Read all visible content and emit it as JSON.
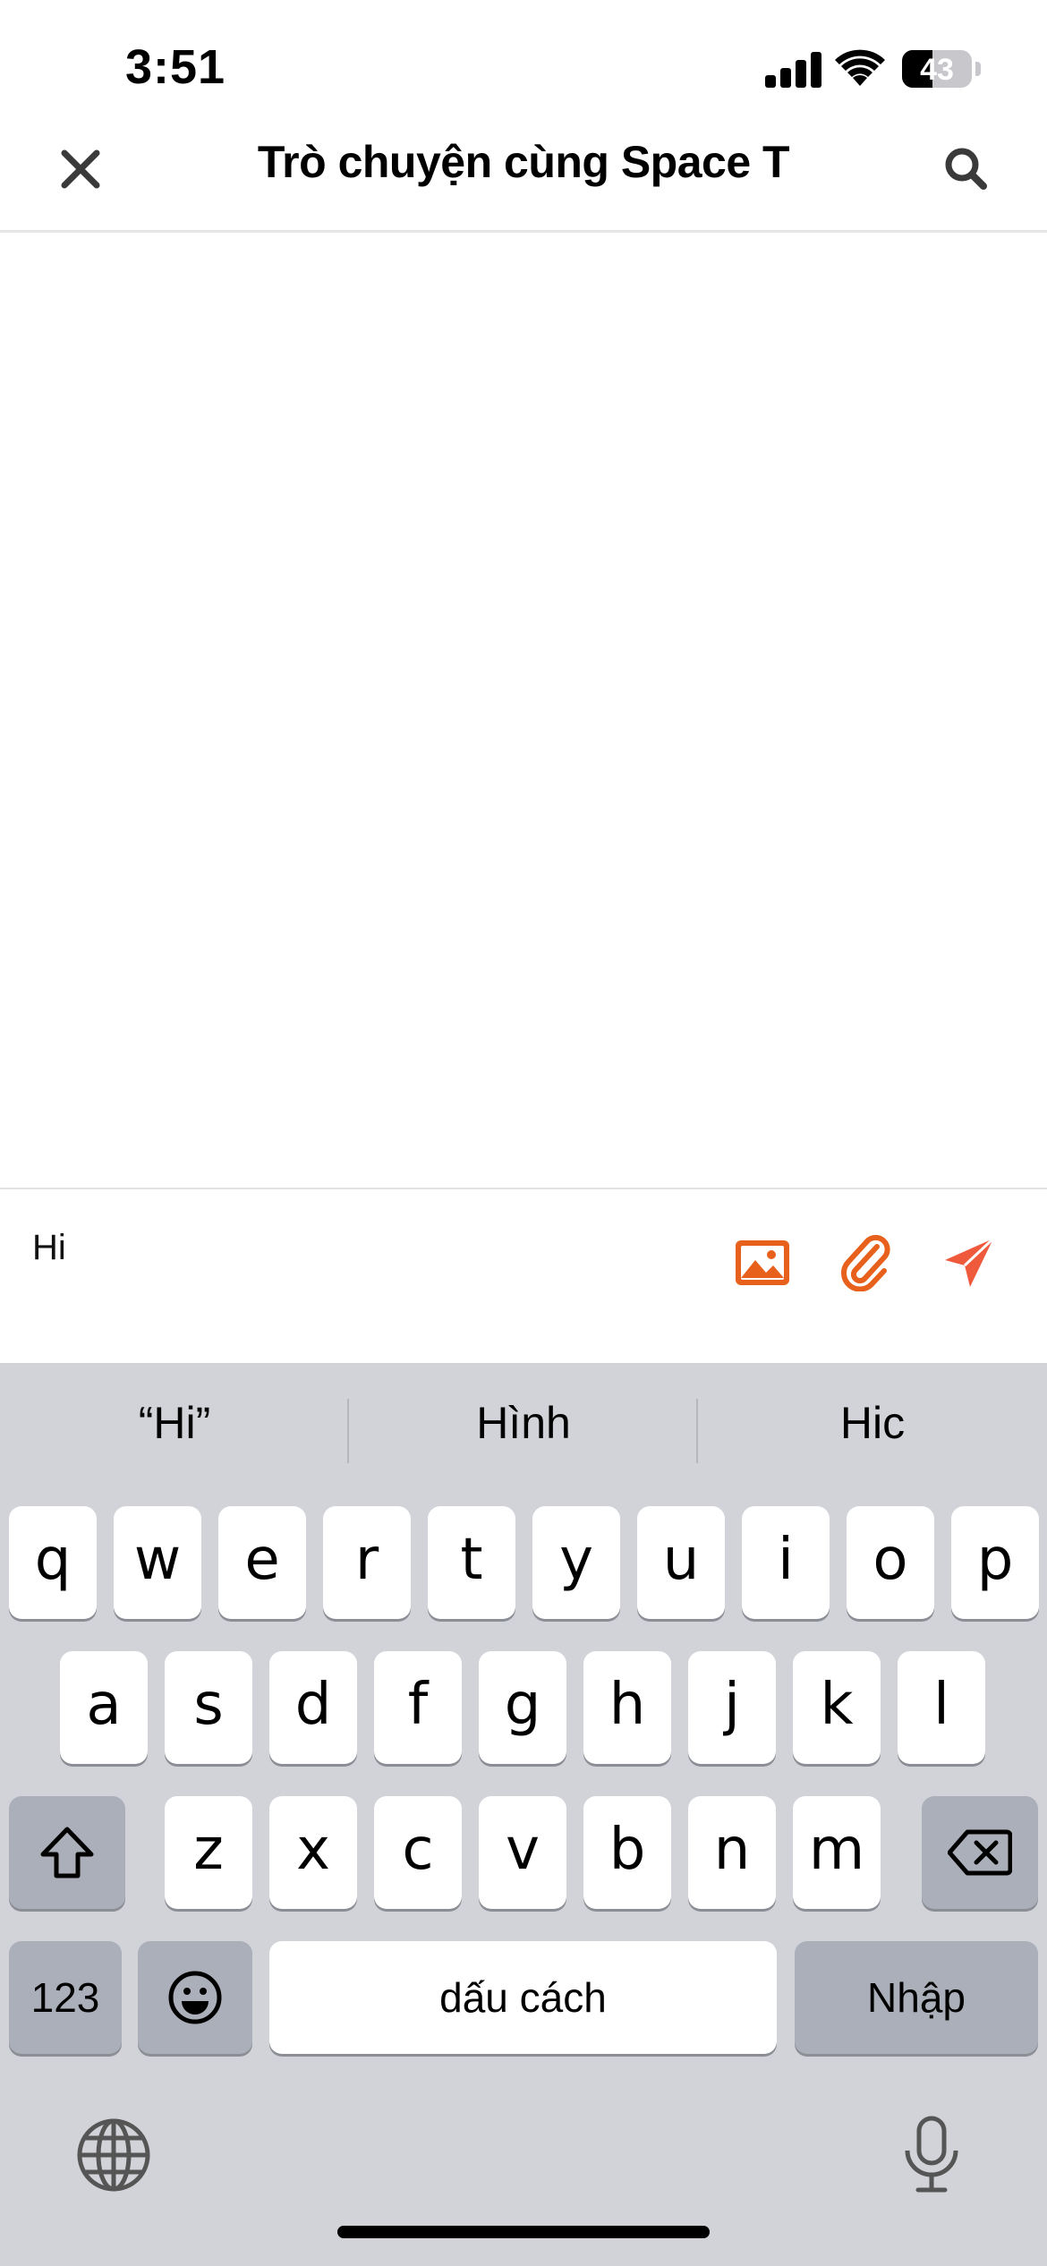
{
  "status_bar": {
    "time": "3:51",
    "battery": "43",
    "battery_level": 0.43
  },
  "header": {
    "title": "Trò chuyện cùng Space T"
  },
  "composer": {
    "value": "Hi"
  },
  "keyboard": {
    "suggestions": [
      "“Hi”",
      "Hình",
      "Hic"
    ],
    "row1": [
      "q",
      "w",
      "e",
      "r",
      "t",
      "y",
      "u",
      "i",
      "o",
      "p"
    ],
    "row2": [
      "a",
      "s",
      "d",
      "f",
      "g",
      "h",
      "j",
      "k",
      "l"
    ],
    "row3": [
      "z",
      "x",
      "c",
      "v",
      "b",
      "n",
      "m"
    ],
    "numbers_label": "123",
    "space_label": "dấu cách",
    "enter_label": "Nhập"
  },
  "colors": {
    "accent_orange": "#e8611c",
    "send_red": "#f05a3c",
    "keyboard_bg": "#d1d3d9"
  },
  "icons": [
    "close-icon",
    "search-icon",
    "image-icon",
    "paperclip-icon",
    "send-icon",
    "shift-icon",
    "backspace-icon",
    "emoji-icon",
    "globe-icon",
    "microphone-icon"
  ]
}
